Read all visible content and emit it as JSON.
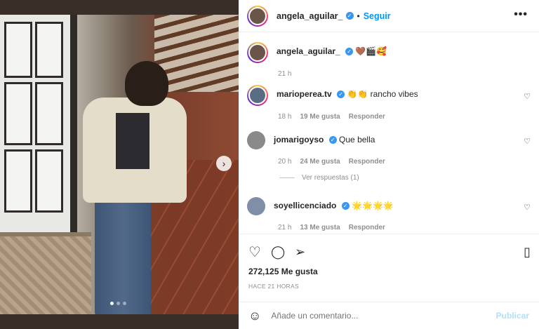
{
  "post": {
    "username": "angela_aguilar_",
    "follow_label": "Seguir",
    "separator": "•",
    "more_label": "•••"
  },
  "caption": {
    "username": "angela_aguilar_",
    "text": "🤎🎬🥰",
    "time": "21 h"
  },
  "comments": [
    {
      "username": "marioperea.tv",
      "text": "👏👏 rancho vibes",
      "time": "18 h",
      "likes": "19 Me gusta",
      "reply": "Responder"
    },
    {
      "username": "jomarigoyso",
      "text": "Que bella",
      "time": "20 h",
      "likes": "24 Me gusta",
      "reply": "Responder"
    },
    {
      "username": "soyellicenciado",
      "text": "🌟🌟🌟🌟",
      "time": "21 h",
      "likes": "13 Me gusta",
      "reply": "Responder"
    }
  ],
  "view_replies": "Ver respuestas (1)",
  "likes": "272,125 Me gusta",
  "timestamp": "HACE 21 HORAS",
  "add_comment": {
    "placeholder": "Añade un comentario...",
    "post_label": "Publicar"
  },
  "colors": {
    "accent": "#0095f6",
    "verified": "#3897f0",
    "muted": "#8e8e8e"
  },
  "icons": {
    "like": "heart-icon",
    "comment": "comment-icon",
    "share": "share-icon",
    "save": "bookmark-icon",
    "emoji": "emoji-icon"
  }
}
